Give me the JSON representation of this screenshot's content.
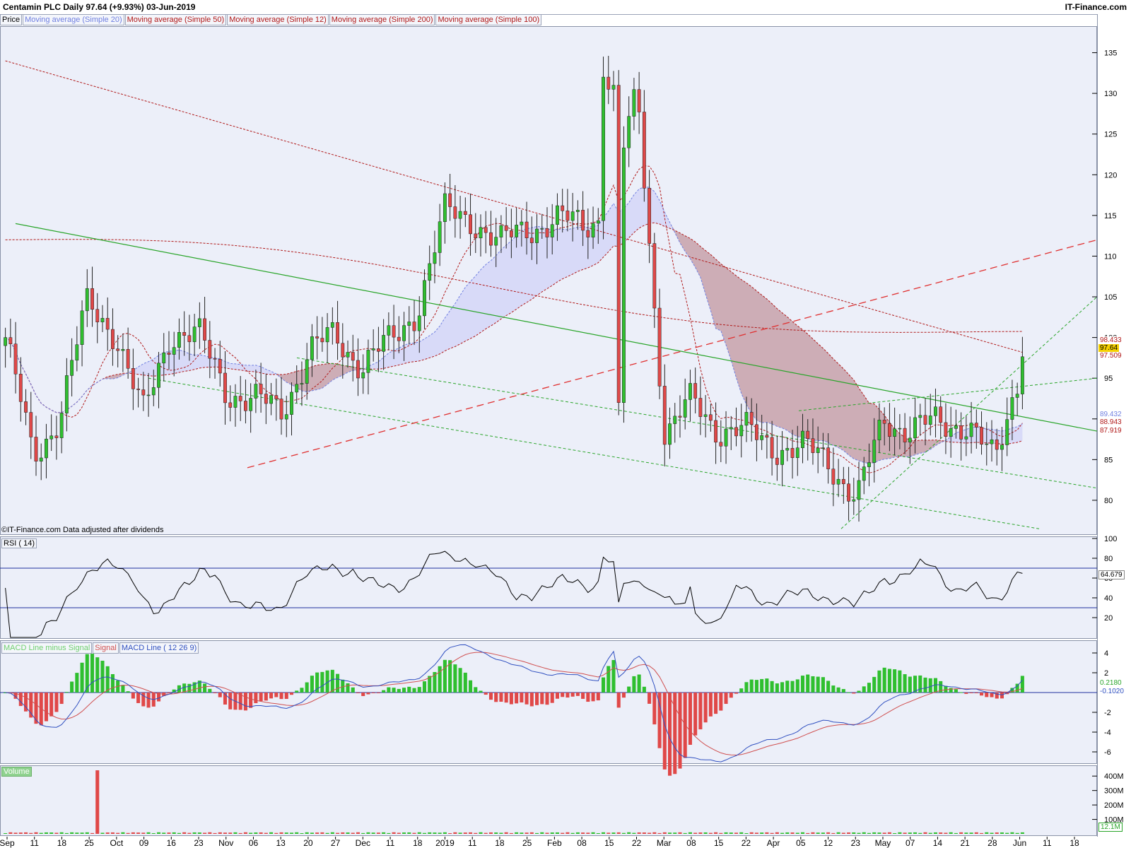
{
  "header": {
    "title": "Centamin PLC   Daily   97.64 (+9.93%)   03-Jun-2019",
    "brand": "IT-Finance.com"
  },
  "legend": {
    "items": [
      {
        "label": "Price",
        "color": "#000000"
      },
      {
        "label": "Moving average (Simple 20)",
        "color": "#6f7fe0"
      },
      {
        "label": "Moving average (Simple 50)",
        "color": "#b01818"
      },
      {
        "label": "Moving average (Simple 12)",
        "color": "#b01818"
      },
      {
        "label": "Moving average (Simple 200)",
        "color": "#b01818"
      },
      {
        "label": "Moving average (Simple 100)",
        "color": "#b01818"
      }
    ]
  },
  "footnote": "©IT-Finance.com  Data adjusted after dividends",
  "rsi": {
    "label": "RSI ( 14)",
    "last_label": "64.679",
    "ticks": [
      "100",
      "80",
      "60",
      "40",
      "20"
    ]
  },
  "macd": {
    "legend": [
      {
        "label": "MACD Line minus Signal",
        "color": "#6fcf6f"
      },
      {
        "label": "Signal",
        "color": "#d05050"
      },
      {
        "label": "MACD Line ( 12 26 9)",
        "color": "#3050c0"
      }
    ],
    "ticks": [
      "4",
      "2",
      "-2",
      "-4",
      "-6"
    ],
    "tags": [
      "0.2180",
      "-0.1020"
    ]
  },
  "volume": {
    "label": "Volume",
    "ticks": [
      "400M",
      "300M",
      "200M",
      "100M"
    ],
    "last_label": "12.1M"
  },
  "price_tags": {
    "close": "97.64",
    "tags": [
      "98.433",
      "97.509",
      "89.432",
      "88.943",
      "87.919"
    ]
  },
  "price_axis_ticks": [
    "135",
    "130",
    "125",
    "120",
    "115",
    "110",
    "105",
    "100",
    "95",
    "90",
    "85",
    "80"
  ],
  "x_axis_labels": [
    "Sep",
    "11",
    "18",
    "25",
    "Oct",
    "09",
    "16",
    "23",
    "Nov",
    "06",
    "13",
    "20",
    "27",
    "Dec",
    "11",
    "18",
    "2019",
    "11",
    "18",
    "25",
    "Feb",
    "08",
    "15",
    "22",
    "Mar",
    "08",
    "15",
    "22",
    "Apr",
    "05",
    "12",
    "23",
    "May",
    "07",
    "14",
    "21",
    "28",
    "Jun",
    "11",
    "18"
  ],
  "colors": {
    "up": "#2fbf2f",
    "down": "#e04848",
    "ma_red": "#b01818",
    "band_red": "#c99a9a",
    "band_blue": "#c8c8f8",
    "trend_green": "#2aa52a",
    "rsi_ob": "#c99a9a",
    "bg": "#eceff9"
  },
  "chart_data": [
    {
      "type": "candlestick",
      "title": "Centamin PLC   Daily   97.64 (+9.93%)   03-Jun-2019",
      "ylim": [
        76,
        138
      ],
      "y_ticks": [
        80,
        85,
        90,
        95,
        100,
        105,
        110,
        115,
        120,
        125,
        130,
        135
      ],
      "last_close": 97.64,
      "anchors_close": [
        {
          "date": "Sep",
          "v": 100
        },
        {
          "date": "11",
          "v": 85
        },
        {
          "date": "18",
          "v": 91
        },
        {
          "date": "25",
          "v": 104
        },
        {
          "date": "Oct",
          "v": 101
        },
        {
          "date": "09",
          "v": 90
        },
        {
          "date": "16",
          "v": 101
        },
        {
          "date": "23",
          "v": 100
        },
        {
          "date": "Nov",
          "v": 94
        },
        {
          "date": "06",
          "v": 92
        },
        {
          "date": "13",
          "v": 91
        },
        {
          "date": "20",
          "v": 98
        },
        {
          "date": "27",
          "v": 100
        },
        {
          "date": "Dec",
          "v": 97
        },
        {
          "date": "11",
          "v": 99
        },
        {
          "date": "18",
          "v": 104
        },
        {
          "date": "2019",
          "v": 115
        },
        {
          "date": "11",
          "v": 115
        },
        {
          "date": "18",
          "v": 111
        },
        {
          "date": "25",
          "v": 114
        },
        {
          "date": "Feb",
          "v": 114
        },
        {
          "date": "08",
          "v": 114
        },
        {
          "date": "15",
          "v": 116
        },
        {
          "date": "22",
          "v": 130
        },
        {
          "date": "Mar",
          "v": 88
        },
        {
          "date": "08",
          "v": 92
        },
        {
          "date": "15",
          "v": 89
        },
        {
          "date": "22",
          "v": 88
        },
        {
          "date": "Apr",
          "v": 87
        },
        {
          "date": "05",
          "v": 86
        },
        {
          "date": "12",
          "v": 85
        },
        {
          "date": "23",
          "v": 80
        },
        {
          "date": "May",
          "v": 90
        },
        {
          "date": "07",
          "v": 89
        },
        {
          "date": "14",
          "v": 89
        },
        {
          "date": "21",
          "v": 90
        },
        {
          "date": "28",
          "v": 84
        },
        {
          "date": "Jun",
          "v": 97.64
        }
      ]
    },
    {
      "type": "line",
      "name": "RSI ( 14)",
      "ylim": [
        0,
        100
      ],
      "y_ticks": [
        20,
        40,
        60,
        80,
        100
      ],
      "last": 64.679
    },
    {
      "type": "bar",
      "name": "MACD Line ( 12 26 9)",
      "ylim": [
        -7,
        5
      ],
      "y_ticks": [
        -6,
        -4,
        -2,
        2,
        4
      ],
      "last_macd": -0.102,
      "last_signal": 0.218
    },
    {
      "type": "bar",
      "name": "Volume",
      "y_ticks": [
        "100M",
        "200M",
        "300M",
        "400M"
      ],
      "last": "12.1M"
    }
  ]
}
